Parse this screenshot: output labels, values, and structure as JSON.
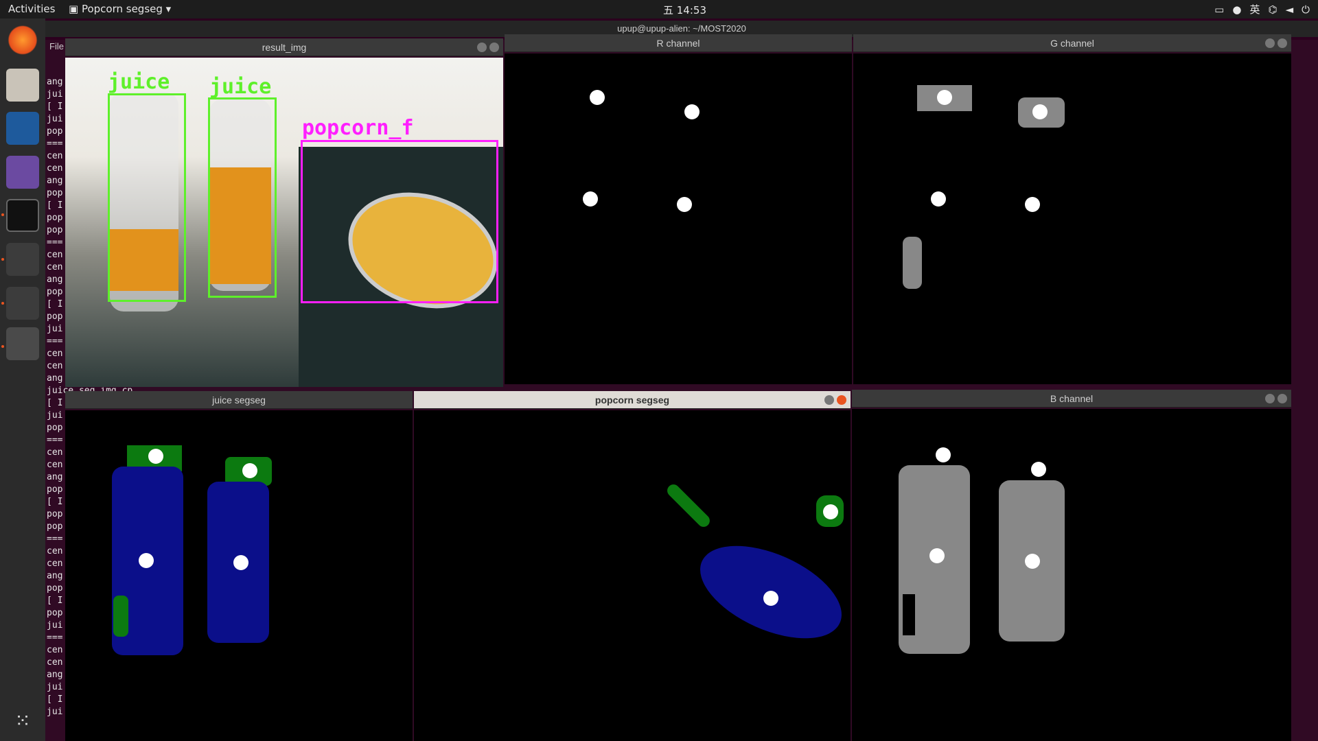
{
  "topbar": {
    "activities": "Activities",
    "app_menu": "Popcorn segseg",
    "clock": "五 14:53",
    "lang": "英",
    "icons": [
      "camera-icon",
      "app-icon",
      "network-icon",
      "volume-icon",
      "power-icon"
    ]
  },
  "terminal": {
    "title": "upup@upup-alien: ~/MOST2020",
    "file_menu": "File",
    "lines": [
      "ang",
      "jui",
      "[ I",
      "jui",
      "pop",
      "===",
      "cen",
      "cen",
      "ang",
      "pop",
      "[ I",
      "pop",
      "pop",
      "===",
      "cen",
      "cen",
      "ang",
      "pop",
      "[ I",
      "pop",
      "jui",
      "===",
      "cen",
      "cen",
      "ang",
      "juice_seg_img.cp",
      "[ I",
      "jui",
      "pop",
      "===",
      "cen",
      "cen",
      "ang",
      "pop",
      "[ I",
      "pop",
      "pop",
      "===",
      "cen",
      "cen",
      "ang",
      "pop",
      "[ I",
      "pop",
      "jui",
      "===",
      "cen",
      "cen",
      "ang",
      "jui",
      "[ I",
      "jui"
    ]
  },
  "windows": {
    "result": {
      "title": "result_img",
      "labels": [
        "juice",
        "juice",
        "popcorn_f"
      ]
    },
    "r_channel": {
      "title": "R channel"
    },
    "g_channel": {
      "title": "G channel"
    },
    "juice": {
      "title": "juice segseg"
    },
    "popcorn": {
      "title": "popcorn segseg"
    },
    "b_channel": {
      "title": "B channel"
    }
  },
  "colors": {
    "juice_box": "#5ef02a",
    "popcorn_box": "#ff1fff",
    "seg_blue": "#0b0f8a",
    "seg_green": "#0c7a10",
    "mask_gray": "#888888"
  }
}
